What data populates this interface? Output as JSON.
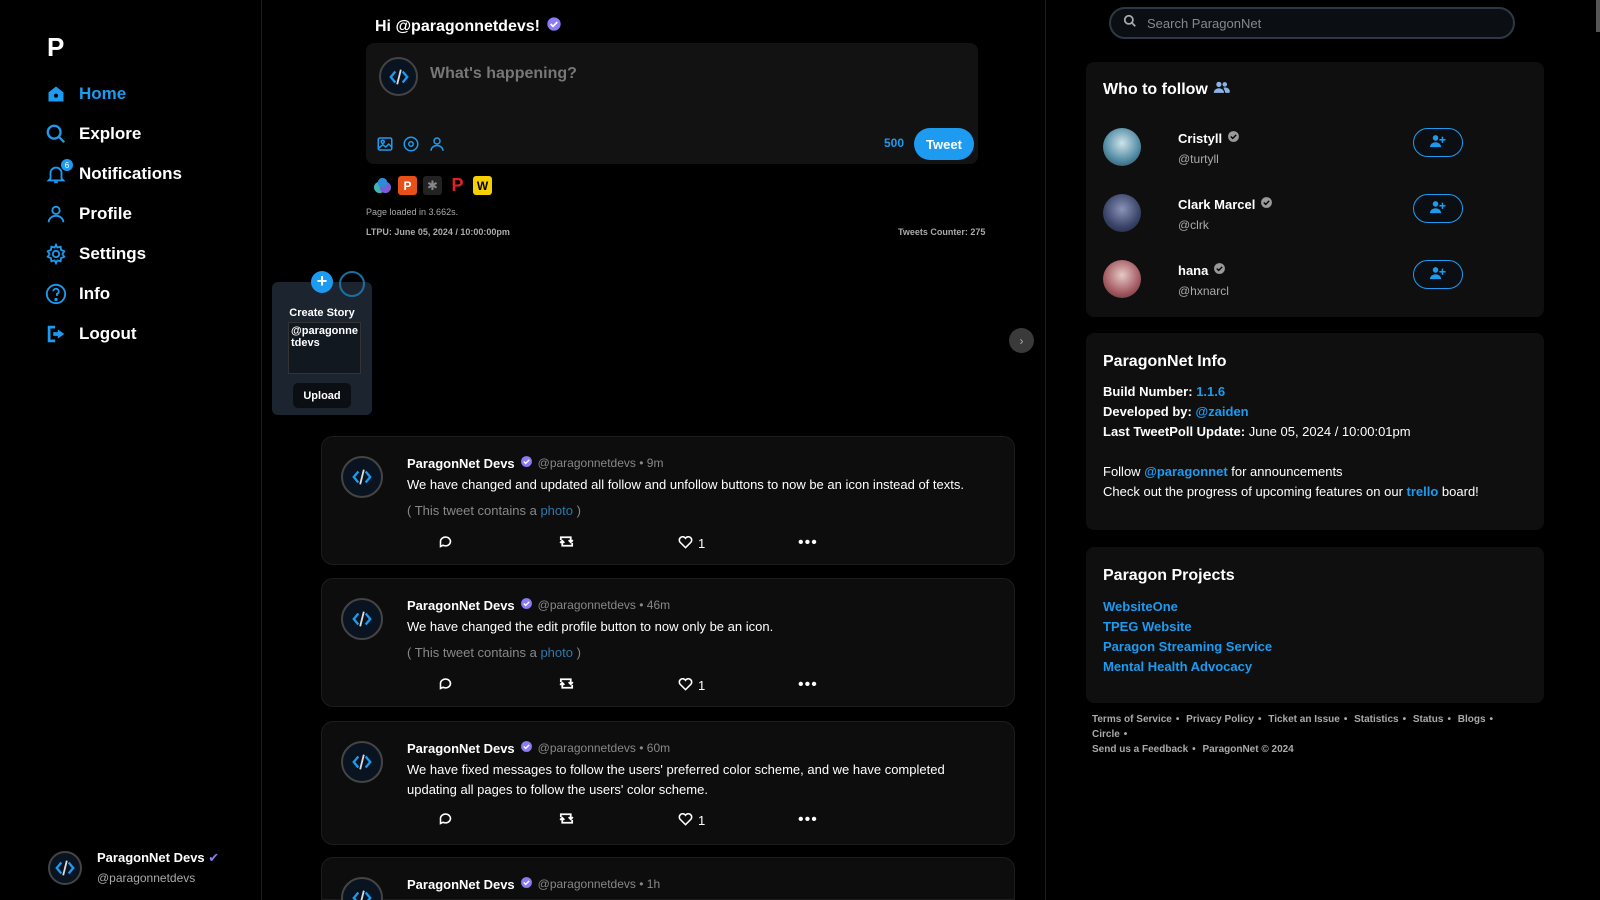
{
  "sidebar": {
    "logo": "P",
    "items": [
      {
        "label": "Home",
        "icon": "home-icon",
        "active": true
      },
      {
        "label": "Explore",
        "icon": "search-icon"
      },
      {
        "label": "Notifications",
        "icon": "bell-icon",
        "badge": "6"
      },
      {
        "label": "Profile",
        "icon": "user-icon"
      },
      {
        "label": "Settings",
        "icon": "gear-icon"
      },
      {
        "label": "Info",
        "icon": "question-icon"
      },
      {
        "label": "Logout",
        "icon": "logout-icon"
      }
    ],
    "user": {
      "name": "ParagonNet Devs",
      "handle": "@paragonnetdevs"
    }
  },
  "composer": {
    "greeting": "Hi @paragonnetdevs!",
    "placeholder": "What's happening?",
    "char_count": "500",
    "tweet_label": "Tweet"
  },
  "status": {
    "page_loaded": "Page loaded in 3.662s.",
    "ltpu": "LTPU: June 05, 2024 / 10:00:00pm",
    "tweets_counter": "Tweets Counter: 275"
  },
  "story": {
    "title": "Create Story",
    "user": "@paragonnetdevs",
    "upload_label": "Upload",
    "next": "›"
  },
  "tweets": [
    {
      "name": "ParagonNet Devs",
      "meta": "@paragonnetdevs • 9m",
      "body": "We have changed and updated all follow and unfollow buttons to now be an icon instead of texts.",
      "photo_pre": "( This tweet contains a ",
      "photo_link": "photo",
      "photo_post": " )",
      "likes": "1"
    },
    {
      "name": "ParagonNet Devs",
      "meta": "@paragonnetdevs • 46m",
      "body": "We have changed the edit profile button to now only be an icon.",
      "photo_pre": "( This tweet contains a ",
      "photo_link": "photo",
      "photo_post": " )",
      "likes": "1"
    },
    {
      "name": "ParagonNet Devs",
      "meta": "@paragonnetdevs • 60m",
      "body": "We have fixed messages to follow the users' preferred color scheme, and we have completed updating all pages to follow the users' color scheme.",
      "likes": "1"
    },
    {
      "name": "ParagonNet Devs",
      "meta": "@paragonnetdevs • 1h"
    }
  ],
  "search": {
    "placeholder": "Search ParagonNet"
  },
  "who_to_follow": {
    "title": "Who to follow",
    "users": [
      {
        "name": "Cristyll",
        "handle": "@turtyll"
      },
      {
        "name": "Clark Marcel",
        "handle": "@clrk"
      },
      {
        "name": "hana",
        "handle": "@hxnarcl"
      }
    ]
  },
  "info": {
    "title": "ParagonNet Info",
    "build_label": "Build Number:",
    "build_value": "1.1.6",
    "dev_label": "Developed by:",
    "dev_value": "@zaiden",
    "update_label": "Last TweetPoll Update:",
    "update_value": "June 05, 2024 / 10:00:01pm",
    "follow_pre": "Follow ",
    "follow_link": "@paragonnet",
    "follow_post": " for announcements",
    "progress_pre": "Check out the progress of upcoming features on our ",
    "progress_link": "trello",
    "progress_post": " board!"
  },
  "projects": {
    "title": "Paragon Projects",
    "items": [
      "WebsiteOne",
      "TPEG Website",
      "Paragon Streaming Service",
      "Mental Health Advocacy"
    ]
  },
  "footer": {
    "links": [
      "Terms of Service",
      "Privacy Policy",
      "Ticket an Issue",
      "Statistics",
      "Status",
      "Blogs",
      "Circle",
      "Send us a Feedback"
    ],
    "copyright": "ParagonNet © 2024"
  },
  "colors": {
    "accent": "#1d9bf0",
    "background": "#000000",
    "verified": "#8b7cf6"
  }
}
